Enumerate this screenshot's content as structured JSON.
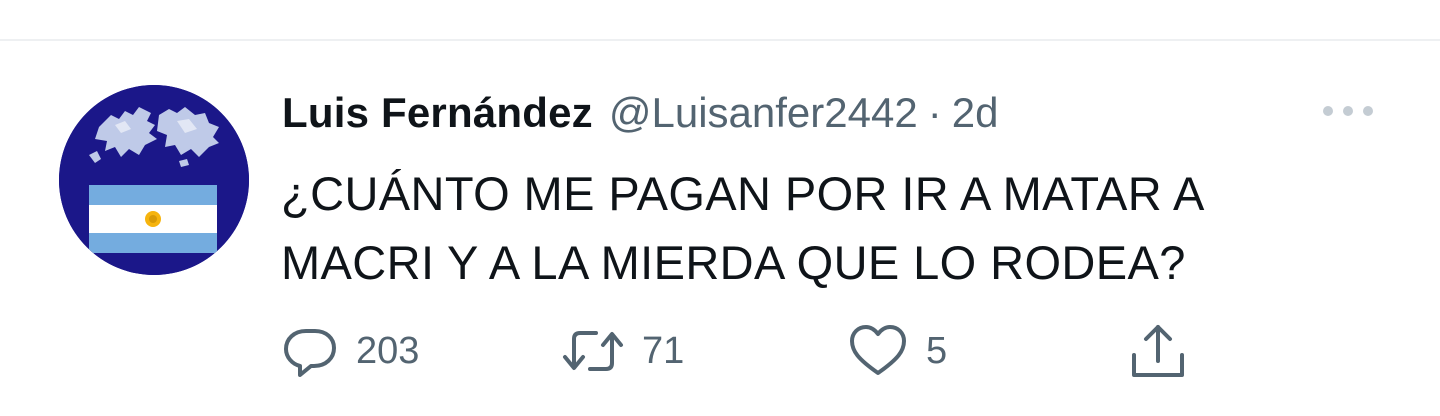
{
  "tweet": {
    "author": {
      "display_name": "Luis Fernández",
      "handle": "@Luisanfer2442"
    },
    "separator": "·",
    "timestamp": "2d",
    "text": "¿CUÁNTO ME PAGAN POR IR A MATAR A MACRI Y A LA MIERDA QUE LO RODEA?",
    "stats": {
      "replies": "203",
      "retweets": "71",
      "likes": "5"
    }
  },
  "icons": {
    "more": "more-horizontal-icon",
    "reply": "reply-speech-bubble-icon",
    "retweet": "retweet-arrows-icon",
    "like": "heart-icon",
    "share": "share-upload-icon"
  },
  "colors": {
    "text_primary": "#0f1419",
    "text_secondary": "#536471",
    "divider": "#eef0f2",
    "avatar_background": "#1b1789",
    "flag_light_blue": "#74acdf"
  }
}
